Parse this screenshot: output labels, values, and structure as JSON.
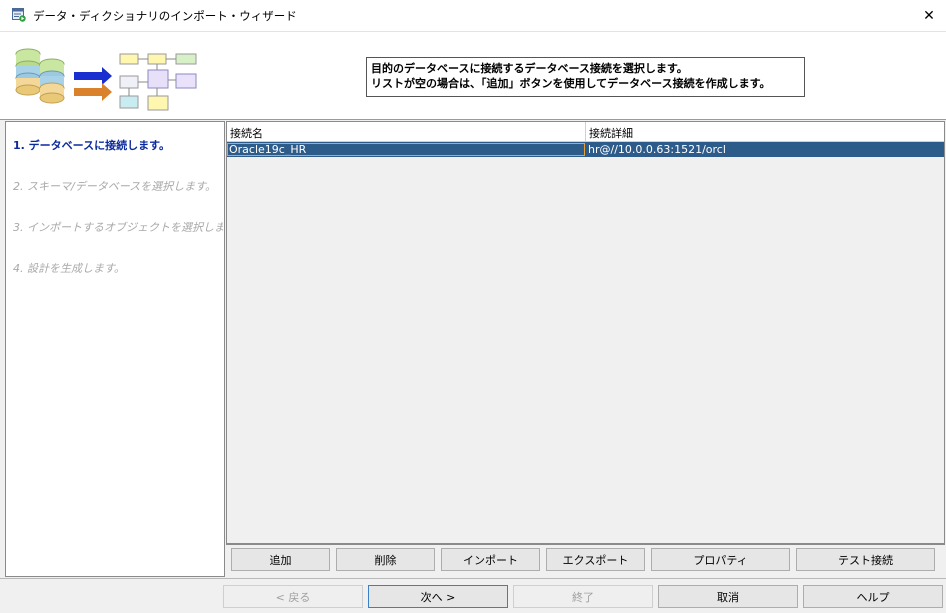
{
  "window": {
    "title": "データ・ディクショナリのインポート・ウィザード",
    "close_glyph": "✕"
  },
  "header": {
    "info_line1": "目的のデータベースに接続するデータベース接続を選択します。",
    "info_line2": "リストが空の場合は、「追加」ボタンを使用してデータベース接続を作成します。"
  },
  "steps": [
    {
      "label": "1. データベースに接続します。",
      "state": "active"
    },
    {
      "label": "2. スキーマ/データベースを選択します。",
      "state": "inactive"
    },
    {
      "label": "3. インポートするオブジェクトを選択しま...",
      "state": "inactive"
    },
    {
      "label": "4. 設計を生成します。",
      "state": "inactive"
    }
  ],
  "table": {
    "columns": [
      "接続名",
      "接続詳細"
    ],
    "rows": [
      {
        "name": "Oracle19c_HR",
        "detail": "hr@//10.0.0.63:1521/orcl",
        "selected": true
      }
    ]
  },
  "actions": {
    "add": "追加",
    "delete": "削除",
    "import": "インポート",
    "export": "エクスポート",
    "properties": "プロパティ",
    "test": "テスト接続"
  },
  "footer": {
    "back": "< 戻る",
    "next": "次へ >",
    "finish": "終了",
    "cancel": "取消",
    "help": "ヘルプ"
  },
  "colors": {
    "selection": "#2e5c8a",
    "active_step": "#0a2a9e",
    "focus_outline": "#e8a13a"
  }
}
